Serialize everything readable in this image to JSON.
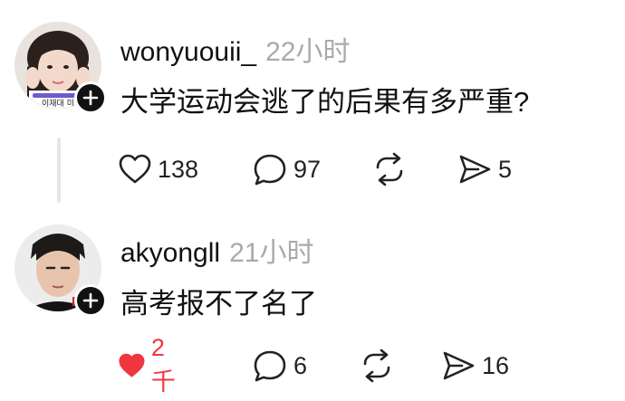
{
  "posts": [
    {
      "username": "wonyuouii_",
      "time": "22小时",
      "text": "大学运动会逃了的后果有多严重?",
      "avatar_badge": "이재대 미",
      "liked": false,
      "actions": {
        "likes": "138",
        "comments": "97",
        "reposts": "",
        "shares": "5"
      }
    },
    {
      "username": "akyongll",
      "time": "21小时",
      "text": "高考报不了名了",
      "liked": true,
      "actions": {
        "likes": "2千",
        "comments": "6",
        "reposts": "",
        "shares": "16"
      }
    }
  ],
  "colors": {
    "like_active": "#f0353f",
    "timestamp": "#aaaaaa",
    "thread_line": "#e6e6e6"
  },
  "icons": [
    "heart-icon",
    "comment-icon",
    "repost-icon",
    "share-icon",
    "plus-icon"
  ]
}
